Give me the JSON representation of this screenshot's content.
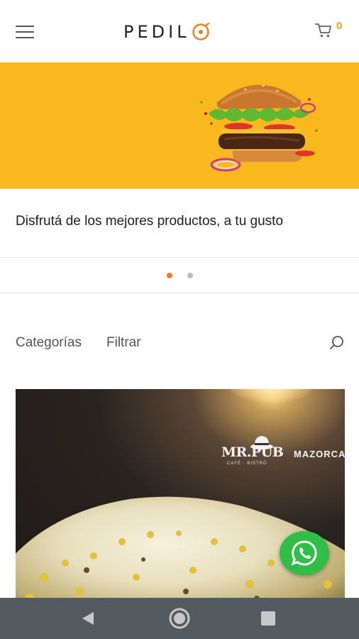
{
  "header": {
    "menu_icon": "hamburger-menu-icon",
    "logo_text": "PEDIL",
    "logo_accent_color": "#f07c1e",
    "cart_icon": "shopping-cart-icon",
    "cart_count": "0"
  },
  "banner": {
    "image": "flying-burger-illustration",
    "background_color": "#f9b91e",
    "tagline": "Disfrutá de los mejores productos, a tu gusto",
    "slides_total": 2,
    "active_slide": 1
  },
  "filters": {
    "categories_label": "Categorías",
    "filter_label": "Filtrar",
    "search_icon": "search-icon"
  },
  "product_card": {
    "brand_logo_text": "MR.PUB",
    "brand_logo_sub": "CAFÉ · BISTRÓ",
    "product_name": "MAZORCA",
    "image": "corn-with-cheese-photo"
  },
  "whatsapp": {
    "icon": "whatsapp-icon",
    "color": "#2fbf47"
  },
  "system_nav": {
    "back_icon": "back-triangle-icon",
    "home_icon": "home-circle-icon",
    "recents_icon": "recents-square-icon"
  }
}
